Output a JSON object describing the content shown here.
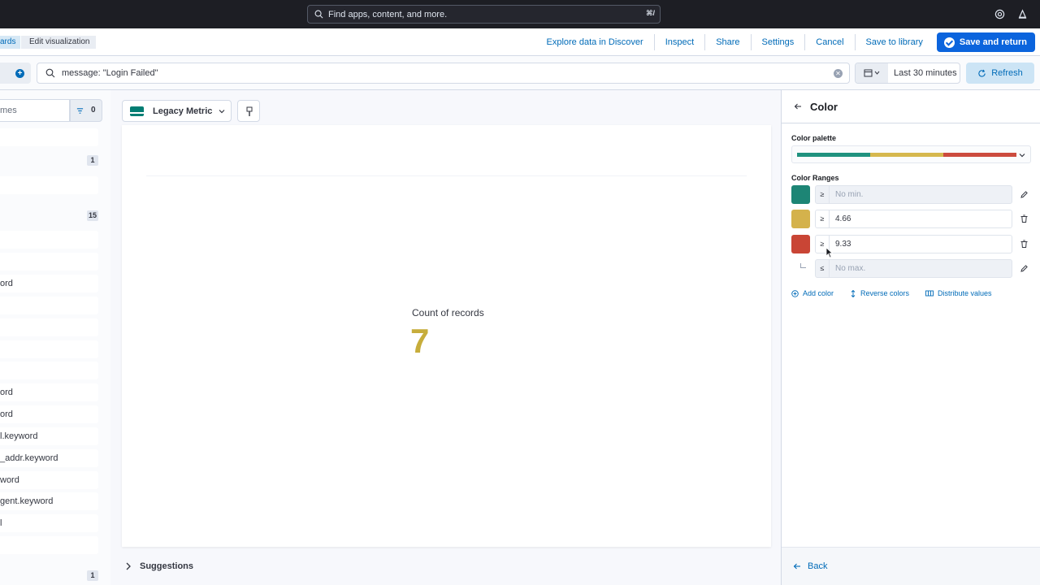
{
  "global_search": {
    "placeholder": "Find apps, content, and more.",
    "shortcut": "⌘/"
  },
  "breadcrumbs": [
    {
      "label": "ards"
    },
    {
      "label": "Edit visualization"
    }
  ],
  "top_links": {
    "explore": "Explore data in Discover",
    "inspect": "Inspect",
    "share": "Share",
    "settings": "Settings",
    "cancel": "Cancel",
    "save_library": "Save to library",
    "save_return": "Save and return"
  },
  "query": {
    "value": "message: \"Login Failed\""
  },
  "date_picker": {
    "label": "Last 30 minutes"
  },
  "refresh_label": "Refresh",
  "field_list": {
    "search_placeholder": "mes",
    "filter_count": "0",
    "group_counts": [
      "1",
      "15",
      "1"
    ],
    "fields": [
      "ord",
      "ord",
      "ord",
      "l.keyword",
      "_addr.keyword",
      "word",
      "gent.keyword",
      "l"
    ]
  },
  "visualization": {
    "type_label": "Legacy Metric",
    "type_icon": "metric-icon"
  },
  "metric": {
    "label": "Count of records",
    "value": "7",
    "color": "#c7ad3b"
  },
  "suggestions_label": "Suggestions",
  "color_panel": {
    "title": "Color",
    "palette_label": "Color palette",
    "palette_colors": [
      "#20927f",
      "#d6b84e",
      "#cc4b3e"
    ],
    "ranges_label": "Color Ranges",
    "ranges": [
      {
        "color": "#1d8575",
        "operator": "≥",
        "placeholder": "No min.",
        "value": "",
        "action_icon": "pencil-icon"
      },
      {
        "color": "#d4b24c",
        "operator": "≥",
        "placeholder": "",
        "value": "4.66",
        "action_icon": "trash-icon"
      },
      {
        "color": "#c94535",
        "operator": "≥",
        "placeholder": "",
        "value": "9.33",
        "action_icon": "trash-icon"
      },
      {
        "color": "",
        "operator": "≤",
        "placeholder": "No max.",
        "value": "",
        "action_icon": "pencil-icon"
      }
    ],
    "actions": {
      "add_color": "Add color",
      "reverse_colors": "Reverse colors",
      "distribute_values": "Distribute values"
    },
    "back_label": "Back"
  }
}
